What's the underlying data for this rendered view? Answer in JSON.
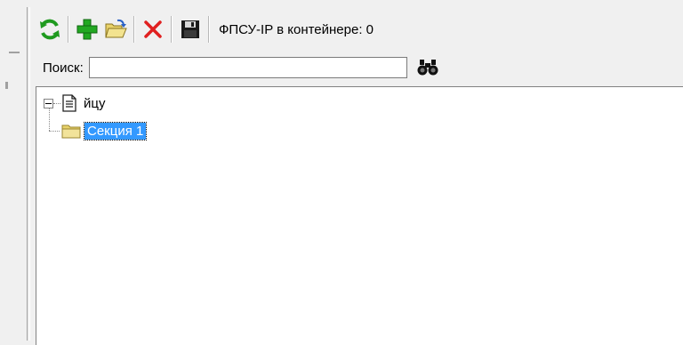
{
  "toolbar": {
    "buttons": [
      {
        "name": "refresh-button",
        "icon": "refresh-icon"
      },
      {
        "name": "add-button",
        "icon": "plus-icon"
      },
      {
        "name": "open-button",
        "icon": "open-folder-icon"
      },
      {
        "name": "delete-button",
        "icon": "close-icon"
      },
      {
        "name": "save-button",
        "icon": "floppy-disk-icon"
      }
    ],
    "status_text": "ФПСУ-IP в контейнере: 0"
  },
  "search": {
    "label": "Поиск:",
    "value": "",
    "find_icon": "binoculars-icon"
  },
  "tree": {
    "root": {
      "label": "йцу",
      "icon": "document-icon",
      "expanded": true
    },
    "children": [
      {
        "label": "Секция 1",
        "icon": "folder-icon",
        "selected": true
      }
    ]
  },
  "colors": {
    "selection": "#3399ff",
    "refresh": "#2bb32b",
    "add": "#22a822",
    "delete": "#e02020",
    "folder": "#e8d26a"
  }
}
